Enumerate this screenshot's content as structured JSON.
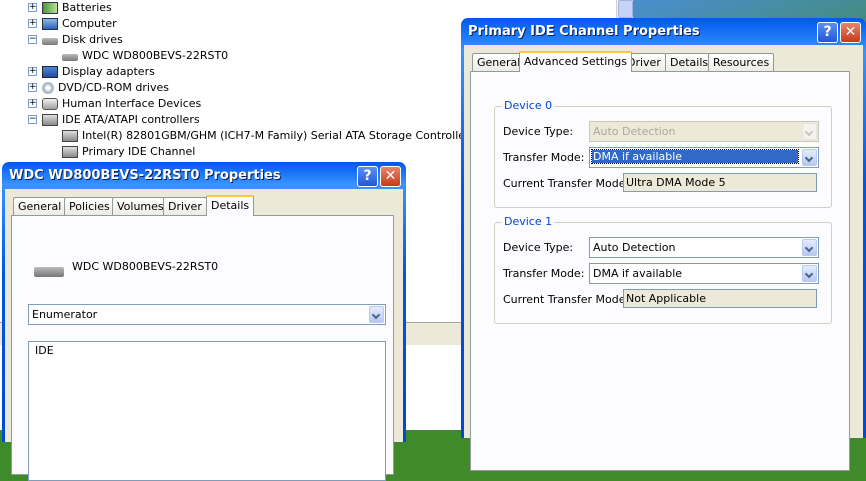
{
  "device_manager": {
    "tree": [
      {
        "label": "Batteries",
        "icon": "battery-icon",
        "state": "collapsed"
      },
      {
        "label": "Computer",
        "icon": "computer-icon",
        "state": "collapsed"
      },
      {
        "label": "Disk drives",
        "icon": "disk-drive-icon",
        "state": "expanded"
      },
      {
        "label": "WDC WD800BEVS-22RST0",
        "icon": "disk-drive-icon",
        "state": "leaf"
      },
      {
        "label": "Display adapters",
        "icon": "display-adapter-icon",
        "state": "collapsed"
      },
      {
        "label": "DVD/CD-ROM drives",
        "icon": "cd-drive-icon",
        "state": "collapsed"
      },
      {
        "label": "Human Interface Devices",
        "icon": "hid-icon",
        "state": "collapsed"
      },
      {
        "label": "IDE ATA/ATAPI controllers",
        "icon": "ide-controller-icon",
        "state": "expanded"
      },
      {
        "label": "Intel(R) 82801GBM/GHM (ICH7-M Family) Serial ATA Storage Controller - 27C4",
        "icon": "ide-controller-icon",
        "state": "leaf"
      },
      {
        "label": "Primary IDE Channel",
        "icon": "ide-controller-icon",
        "state": "leaf"
      }
    ]
  },
  "wdc_dialog": {
    "title": "WDC WD800BEVS-22RST0 Properties",
    "tabs": [
      "General",
      "Policies",
      "Volumes",
      "Driver",
      "Details"
    ],
    "active_tab": "Details",
    "device_name": "WDC WD800BEVS-22RST0",
    "property_select": "Enumerator",
    "value_list": [
      "IDE"
    ]
  },
  "ide_dialog": {
    "title": "Primary IDE Channel Properties",
    "tabs": [
      "General",
      "Advanced Settings",
      "Driver",
      "Details",
      "Resources"
    ],
    "active_tab": "Advanced Settings",
    "device0": {
      "title": "Device 0",
      "device_type_label": "Device Type:",
      "device_type_value": "Auto Detection",
      "transfer_mode_label": "Transfer Mode:",
      "transfer_mode_value": "DMA if available",
      "current_mode_label": "Current Transfer Mode:",
      "current_mode_value": "Ultra DMA Mode 5"
    },
    "device1": {
      "title": "Device 1",
      "device_type_label": "Device Type:",
      "device_type_value": "Auto Detection",
      "transfer_mode_label": "Transfer Mode:",
      "transfer_mode_value": "DMA if available",
      "current_mode_label": "Current Transfer Mode:",
      "current_mode_value": "Not Applicable"
    }
  },
  "colors": {
    "xp_title_blue": "#0055e5",
    "dialog_face": "#ece9d8",
    "group_title": "#0046d5",
    "selection": "#316ac5"
  }
}
